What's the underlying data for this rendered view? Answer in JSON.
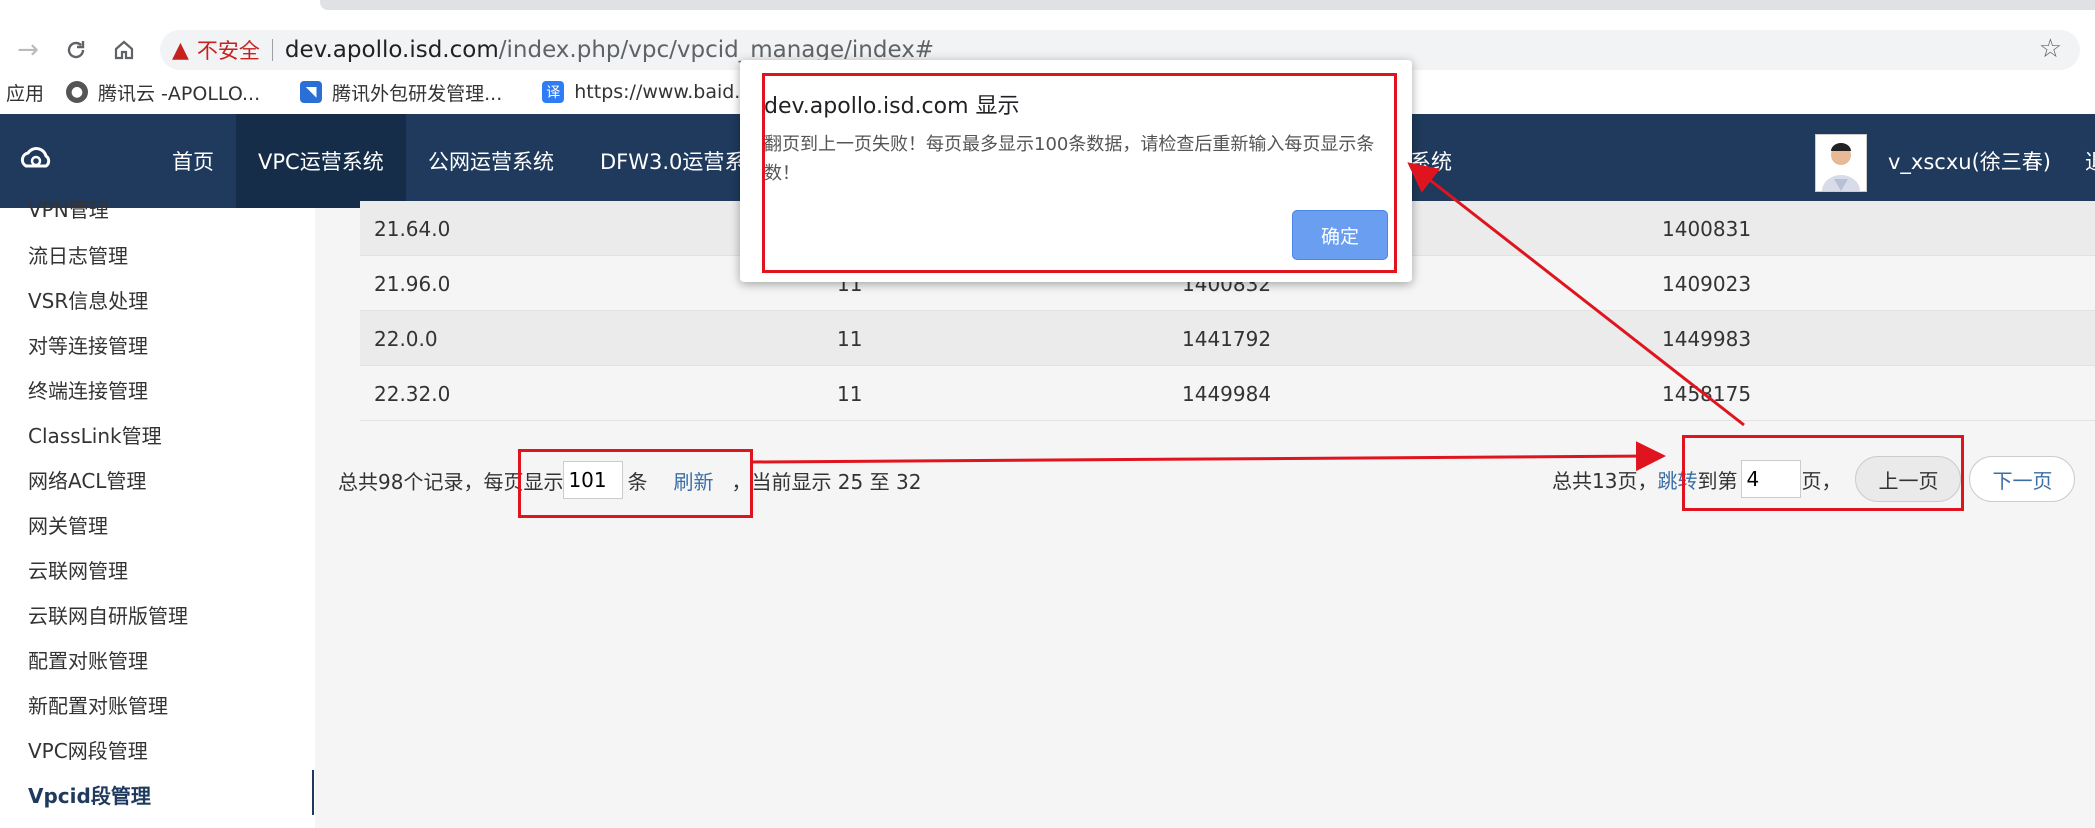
{
  "browser": {
    "warning_text": "不安全",
    "url_host": "dev.apollo.isd.com",
    "url_path": "/index.php/vpc/vpcid_manage/index#",
    "bookmarks": [
      "应用",
      "腾讯云 -APOLLO...",
      "腾讯外包研发管理...",
      "https://www.baid..."
    ]
  },
  "header": {
    "nav": [
      "首页",
      "VPC运营系统",
      "公网运营系统",
      "DFW3.0运营系",
      "系统"
    ],
    "username": "v_xscxu(徐三春)",
    "username_tail": "退"
  },
  "sidebar": {
    "items": [
      "VPN管理",
      "流日志管理",
      "VSR信息处理",
      "对等连接管理",
      "终端连接管理",
      "ClassLink管理",
      "网络ACL管理",
      "网关管理",
      "云联网管理",
      "云联网自研版管理",
      "配置对账管理",
      "新配置对账管理",
      "VPC网段管理",
      "Vpcid段管理"
    ]
  },
  "table": {
    "rows": [
      [
        "21.64.0",
        "",
        "",
        "1400831"
      ],
      [
        "21.96.0",
        "11",
        "1400832",
        "1409023"
      ],
      [
        "22.0.0",
        "11",
        "1441792",
        "1449983"
      ],
      [
        "22.32.0",
        "11",
        "1449984",
        "1458175"
      ]
    ]
  },
  "pagination": {
    "total_records_text": "总共98个记录，每页显示",
    "page_size": "101",
    "unit": "条",
    "refresh": "刷新",
    "current_range": "，当前显示 25 至 32",
    "total_pages_text": "总共13页，",
    "jump_text": "跳转",
    "to_page_text": "到第",
    "page_input": "4",
    "page_suffix": "页，",
    "prev": "上一页",
    "next": "下一页"
  },
  "dialog": {
    "title": "dev.apollo.isd.com 显示",
    "message": "翻页到上一页失败！每页最多显示100条数据，请检查后重新输入每页显示条数！",
    "ok": "确定"
  },
  "colors": {
    "header_bg": "#1f3a5c",
    "annotation_red": "#e0141e",
    "link": "#3b6ea5"
  }
}
